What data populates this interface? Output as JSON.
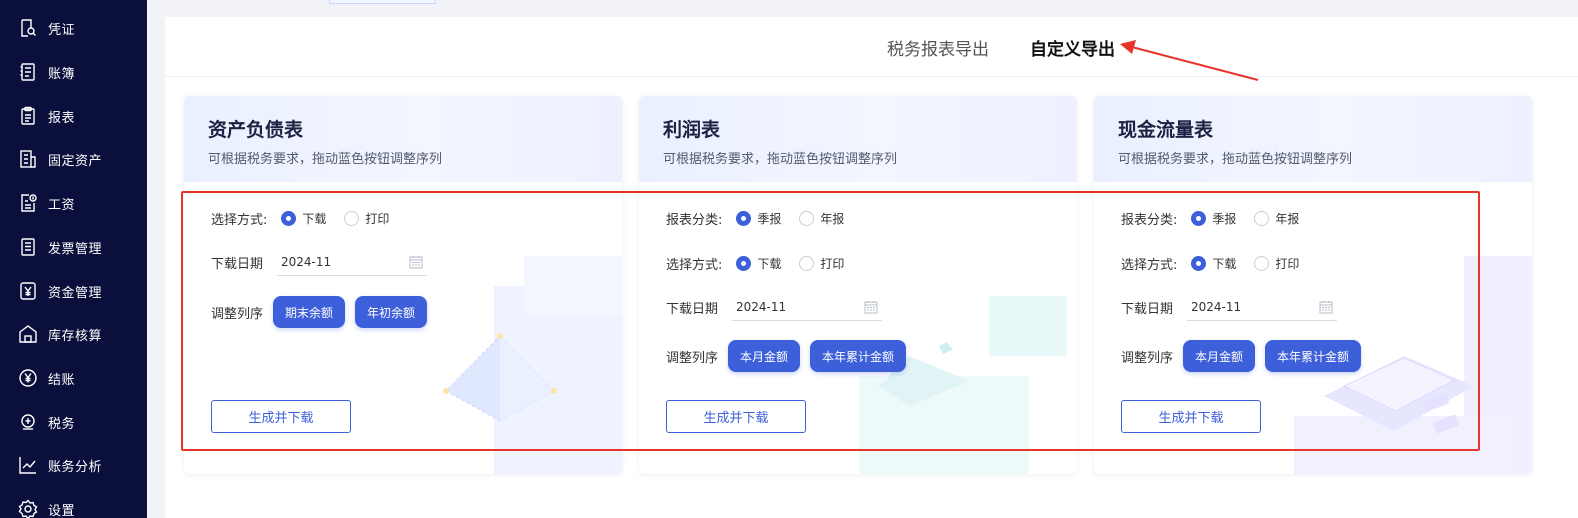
{
  "sidebar": {
    "items": [
      {
        "label": "凭证",
        "icon": "voucher-search-icon"
      },
      {
        "label": "账簿",
        "icon": "ledger-book-icon"
      },
      {
        "label": "报表",
        "icon": "clipboard-report-icon"
      },
      {
        "label": "固定资产",
        "icon": "building-icon"
      },
      {
        "label": "工资",
        "icon": "salary-doc-icon"
      },
      {
        "label": "发票管理",
        "icon": "invoice-icon"
      },
      {
        "label": "资金管理",
        "icon": "yuan-doc-icon"
      },
      {
        "label": "库存核算",
        "icon": "warehouse-icon"
      },
      {
        "label": "结账",
        "icon": "yuan-circle-icon"
      },
      {
        "label": "税务",
        "icon": "tax-icon"
      },
      {
        "label": "账务分析",
        "icon": "line-chart-icon"
      },
      {
        "label": "设置",
        "icon": "gear-icon"
      }
    ]
  },
  "tabs": {
    "tax_export": "税务报表导出",
    "custom_export": "自定义导出"
  },
  "cards": [
    {
      "title": "资产负债表",
      "subtitle": "可根据税务要求，拖动蓝色按钮调整序列",
      "method_label": "选择方式:",
      "method_options": [
        "下载",
        "打印"
      ],
      "date_label": "下载日期",
      "date_value": "2024-11",
      "order_label": "调整列序",
      "order_buttons": [
        "期末余额",
        "年初余额"
      ],
      "action": "生成并下载"
    },
    {
      "title": "利润表",
      "subtitle": "可根据税务要求，拖动蓝色按钮调整序列",
      "category_label": "报表分类:",
      "category_options": [
        "季报",
        "年报"
      ],
      "method_label": "选择方式:",
      "method_options": [
        "下载",
        "打印"
      ],
      "date_label": "下载日期",
      "date_value": "2024-11",
      "order_label": "调整列序",
      "order_buttons": [
        "本月金额",
        "本年累计金额"
      ],
      "action": "生成并下载"
    },
    {
      "title": "现金流量表",
      "subtitle": "可根据税务要求，拖动蓝色按钮调整序列",
      "category_label": "报表分类:",
      "category_options": [
        "季报",
        "年报"
      ],
      "method_label": "选择方式:",
      "method_options": [
        "下载",
        "打印"
      ],
      "date_label": "下载日期",
      "date_value": "2024-11",
      "order_label": "调整列序",
      "order_buttons": [
        "本月金额",
        "本年累计金额"
      ],
      "action": "生成并下载"
    }
  ],
  "colors": {
    "sidebar_bg": "#0b0f3b",
    "accent": "#3d5fd9",
    "annotation": "#e8352c"
  }
}
